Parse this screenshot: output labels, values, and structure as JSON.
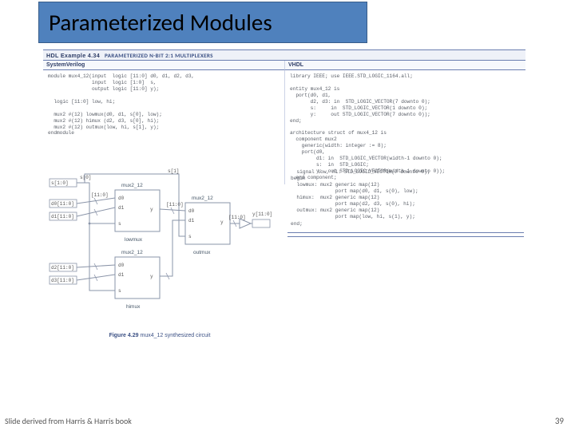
{
  "title": "Parameterized Modules",
  "example": {
    "num": "HDL Example 4.34",
    "name": "PARAMETERIZED N-BIT 2:1 MULTIPLEXERS"
  },
  "columns": {
    "left": "SystemVerilog",
    "right": "VHDL"
  },
  "code": {
    "sv": "module mux4_12(input  logic [11:0] d0, d1, d2, d3,\n               input  logic [1:0]  s,\n               output logic [11:0] y);\n\n  logic [11:0] low, hi;\n\n  mux2 #(12) lowmux(d0, d1, s[0], low);\n  mux2 #(12) himux (d2, d3, s[0], hi);\n  mux2 #(12) outmux(low, hi, s[1], y);\nendmodule",
    "vhdl_top": "library IEEE; use IEEE.STD_LOGIC_1164.all;\n\nentity mux4_12 is\n  port(d0, d1,\n       d2, d3: in  STD_LOGIC_VECTOR(7 downto 0);\n       s:     in  STD_LOGIC_VECTOR(1 downto 0);\n       y:     out STD_LOGIC_VECTOR(7 downto 0));\nend;\n\narchitecture struct of mux4_12 is\n  component mux2\n    generic(width: integer := 8);\n    port(d0,\n         d1: in  STD_LOGIC_VECTOR(width-1 downto 0);\n         s:  in  STD_LOGIC;\n         y:  out STD_LOGIC_VECTOR(width-1 downto 0));\n  end component;",
    "vhdl_bot": "  signal low, hi: STD_LOGIC_VECTOR(7 downto 0);\nbegin\n  lowmux: mux2 generic map(12)\n               port map(d0, d1, s(0), low);\n  himux:  mux2 generic map(12)\n               port map(d2, d3, s(0), hi);\n  outmux: mux2 generic map(12)\n               port map(low, hi, s(1), y);\nend;"
  },
  "figure": {
    "num": "Figure 4.29",
    "caption": "mux4_12 synthesized circuit"
  },
  "sch": {
    "blocks": {
      "low": "mux2_12",
      "hi": "mux2_12",
      "out": "mux2_12"
    },
    "inst": {
      "low": "lowmux",
      "hi": "himux",
      "out": "outmux"
    },
    "ports_in": [
      "s[1:0]",
      "d0[11:0]",
      "d1[11:0]",
      "d2[11:0]",
      "d3[11:0]"
    ],
    "port_out": "y[11:0]",
    "bus12": "[11:0]",
    "s0": "s[0]",
    "s1": "s[1]"
  },
  "footer": {
    "left": "Slide derived from Harris & Harris book",
    "right": "39"
  }
}
